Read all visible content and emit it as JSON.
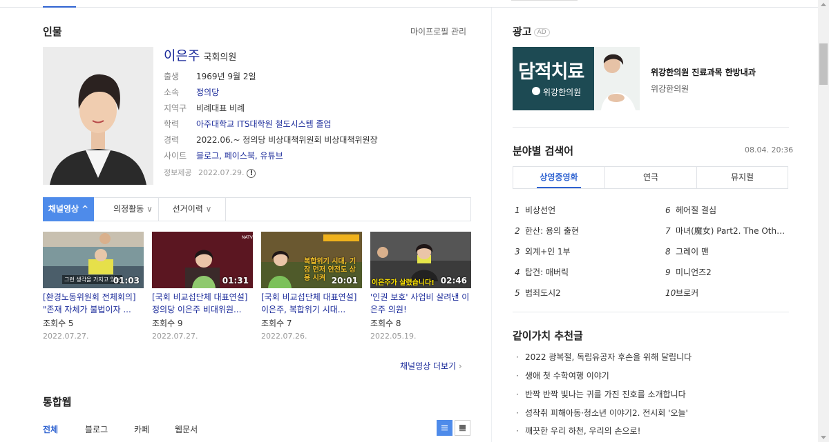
{
  "person": {
    "section_title": "인물",
    "manage_link": "마이프로필 관리",
    "name": "이은주",
    "position": "국회의원",
    "info": [
      {
        "key": "출생",
        "value": "1969년 9월 2일"
      },
      {
        "key": "소속",
        "value": "정의당"
      },
      {
        "key": "지역구",
        "value": "비례대표 비례"
      },
      {
        "key": "학력",
        "value": "아주대학교 ITS대학원 철도시스템 졸업"
      },
      {
        "key": "경력",
        "value": "2022.06.~ 정의당 비상대책위원회 비상대책위원장"
      },
      {
        "key": "사이트",
        "value": "블로그, 페이스북, 유튜브"
      }
    ],
    "provider_key": "정보제공",
    "provider_date": "2022.07.29.",
    "alert_glyph": "!"
  },
  "tabs": [
    "채널영상",
    "의정활동",
    "선거이력"
  ],
  "videos": [
    {
      "duration": "01:03",
      "title": "[환경노동위원회 전체회의] \"존재 자체가 불법이자 ...",
      "views": "조회수 5",
      "date": "2022.07.27.",
      "caption": "그런 생각을 가지고 있는"
    },
    {
      "duration": "01:31",
      "title": "[국회 비교섭단체 대표연설] 정의당 이은주 비대위원...",
      "views": "조회수 9",
      "date": "2022.07.27.",
      "caption": ""
    },
    {
      "duration": "20:01",
      "title": "[국회 비교섭단체 대표연설] 이은주, 복합위기 시대...",
      "views": "조회수 7",
      "date": "2022.07.26.",
      "caption": "복합위기 시대, 기장 먼저 안전도 상용 시켜"
    },
    {
      "duration": "02:46",
      "title": "'인권 보호' 사업비 살려낸 이은주 의원!",
      "views": "조회수 8",
      "date": "2022.05.19.",
      "caption": "이은주가 살렸습니다!"
    }
  ],
  "more_videos": "채널영상 더보기",
  "web_section": {
    "title": "통합웹",
    "filters": [
      "전체",
      "블로그",
      "카페",
      "웹문서"
    ]
  },
  "ad": {
    "section_title": "광고",
    "badge": "AD",
    "image_headline": "담적치료",
    "image_brand": "위강한의원",
    "title": "위강한의원 진료과목 한방내과",
    "subtitle": "위강한의원"
  },
  "keywords": {
    "title": "분야별 검색어",
    "date": "08.04. 20:36",
    "tabs": [
      "상영중영화",
      "연극",
      "뮤지컬"
    ],
    "items": [
      {
        "num": "1",
        "text": "비상선언"
      },
      {
        "num": "2",
        "text": "한산: 용의 출현"
      },
      {
        "num": "3",
        "text": "외계+인 1부"
      },
      {
        "num": "4",
        "text": "탑건: 매버릭"
      },
      {
        "num": "5",
        "text": "범죄도시2"
      },
      {
        "num": "6",
        "text": "헤어질 결심"
      },
      {
        "num": "7",
        "text": "마녀(魔女) Part2. The Oth…"
      },
      {
        "num": "8",
        "text": "그레이 맨"
      },
      {
        "num": "9",
        "text": "미니언즈2"
      },
      {
        "num": "10",
        "text": "브로커"
      }
    ]
  },
  "recommend": {
    "title": "같이가치 추천글",
    "items": [
      "2022 광복절, 독립유공자 후손을 위해 달립니다",
      "생애 첫 수학여행 이야기",
      "반짝 반짝 빛나는 귀를 가진 진호를 소개합니다",
      "성착취 피해아동·청소년 이야기2. 전시회 '오늘'",
      "깨끗한 우리 하천, 우리의 손으로!"
    ]
  },
  "colors": {
    "accent": "#2f63d1",
    "tab_active": "#4e8bea",
    "link": "#1a2a9a"
  },
  "icons": {
    "tab_chevron": "chevron-icon",
    "more_chevron": "chevron-right-icon",
    "list_view": "list-view-icon",
    "grid_view": "grid-view-icon"
  }
}
